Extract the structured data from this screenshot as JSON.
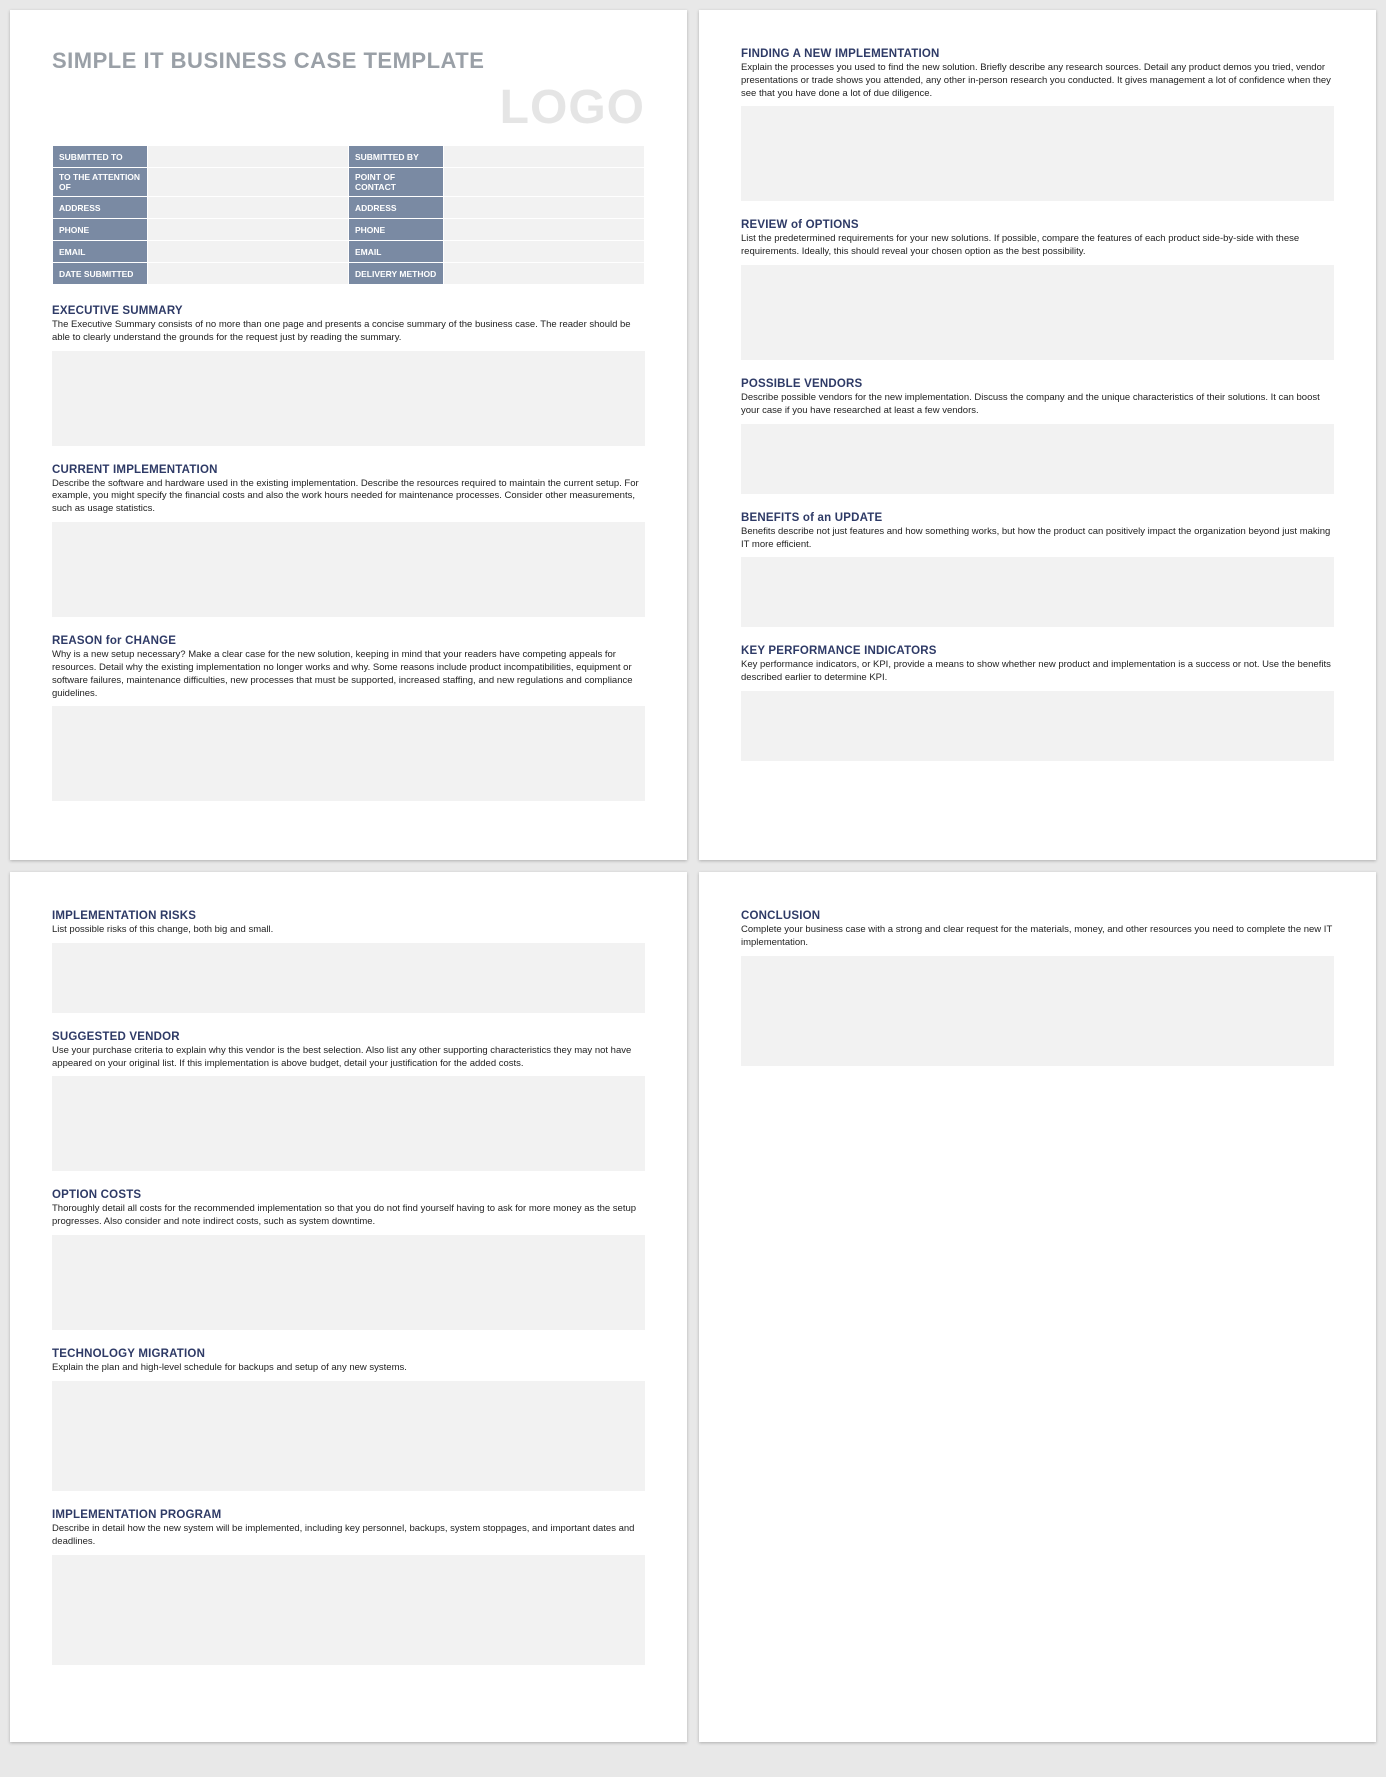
{
  "doc_title": "SIMPLE IT BUSINESS CASE TEMPLATE",
  "logo_text": "LOGO",
  "info_labels": {
    "submitted_to": "SUBMITTED TO",
    "submitted_by": "SUBMITTED BY",
    "attention_of": "TO THE ATTENTION OF",
    "point_of_contact": "POINT OF CONTACT",
    "address_l": "ADDRESS",
    "address_r": "ADDRESS",
    "phone_l": "PHONE",
    "phone_r": "PHONE",
    "email_l": "EMAIL",
    "email_r": "EMAIL",
    "date_submitted": "DATE SUBMITTED",
    "delivery_method": "DELIVERY METHOD"
  },
  "sections": {
    "exec_summary": {
      "title": "EXECUTIVE SUMMARY",
      "desc": "The Executive Summary consists of no more than one page and presents a concise summary of the business case. The reader should be able to clearly understand the grounds for the request just by reading the summary."
    },
    "current_impl": {
      "title": "CURRENT IMPLEMENTATION",
      "desc": "Describe the software and hardware used in the existing implementation. Describe the resources required to maintain the current setup. For example, you might specify the financial costs and also the work hours needed for maintenance processes. Consider other measurements, such as usage statistics."
    },
    "reason_change": {
      "title": "REASON for CHANGE",
      "desc": "Why is a new setup necessary? Make a clear case for the new solution, keeping in mind that your readers have competing appeals for resources. Detail why the existing implementation no longer works and why. Some reasons include product incompatibilities, equipment or software failures, maintenance difficulties, new processes that must be supported, increased staffing, and new regulations and compliance guidelines."
    },
    "finding_impl": {
      "title": "FINDING A NEW IMPLEMENTATION",
      "desc": "Explain the processes you used to find the new solution. Briefly describe any research sources. Detail any product demos you tried, vendor presentations or trade shows you attended, any other in-person research you conducted. It gives management a lot of confidence when they see that you have done a lot of due diligence."
    },
    "review_options": {
      "title": "REVIEW of OPTIONS",
      "desc": "List the predetermined requirements for your new solutions. If possible, compare the features of each product side-by-side with these requirements. Ideally, this should reveal your chosen option as the best possibility."
    },
    "possible_vendors": {
      "title": "POSSIBLE VENDORS",
      "desc": "Describe possible vendors for the new implementation. Discuss the company and the unique characteristics of their solutions. It can boost your case if you have researched at least a few vendors."
    },
    "benefits_update": {
      "title": "BENEFITS of an UPDATE",
      "desc": "Benefits describe not just features and how something works, but how the product can positively impact the organization beyond just making IT more efficient."
    },
    "kpi": {
      "title": "KEY PERFORMANCE INDICATORS",
      "desc": "Key performance indicators, or KPI, provide a means to show whether new product and implementation is a success or not. Use the benefits described earlier to determine KPI."
    },
    "impl_risks": {
      "title": "IMPLEMENTATION RISKS",
      "desc": "List possible risks of this change, both big and small."
    },
    "suggested_vendor": {
      "title": "SUGGESTED VENDOR",
      "desc": "Use your purchase criteria to explain why this vendor is the best selection. Also list any other supporting characteristics they may not have appeared on your original list. If this implementation is above budget, detail your justification for the added costs."
    },
    "option_costs": {
      "title": "OPTION COSTS",
      "desc": "Thoroughly detail all costs for the recommended implementation so that you do not find yourself having to ask for more money as the setup progresses. Also consider and note indirect costs, such as system downtime."
    },
    "tech_migration": {
      "title": "TECHNOLOGY MIGRATION",
      "desc": "Explain the plan and high-level schedule for backups and setup of any new systems."
    },
    "impl_program": {
      "title": "IMPLEMENTATION PROGRAM",
      "desc": "Describe in detail how the new system will be implemented, including key personnel, backups, system stoppages, and important dates and deadlines."
    },
    "conclusion": {
      "title": "CONCLUSION",
      "desc": "Complete your business case with a strong and clear request for the materials, money, and other resources you need to complete the new IT implementation."
    }
  }
}
